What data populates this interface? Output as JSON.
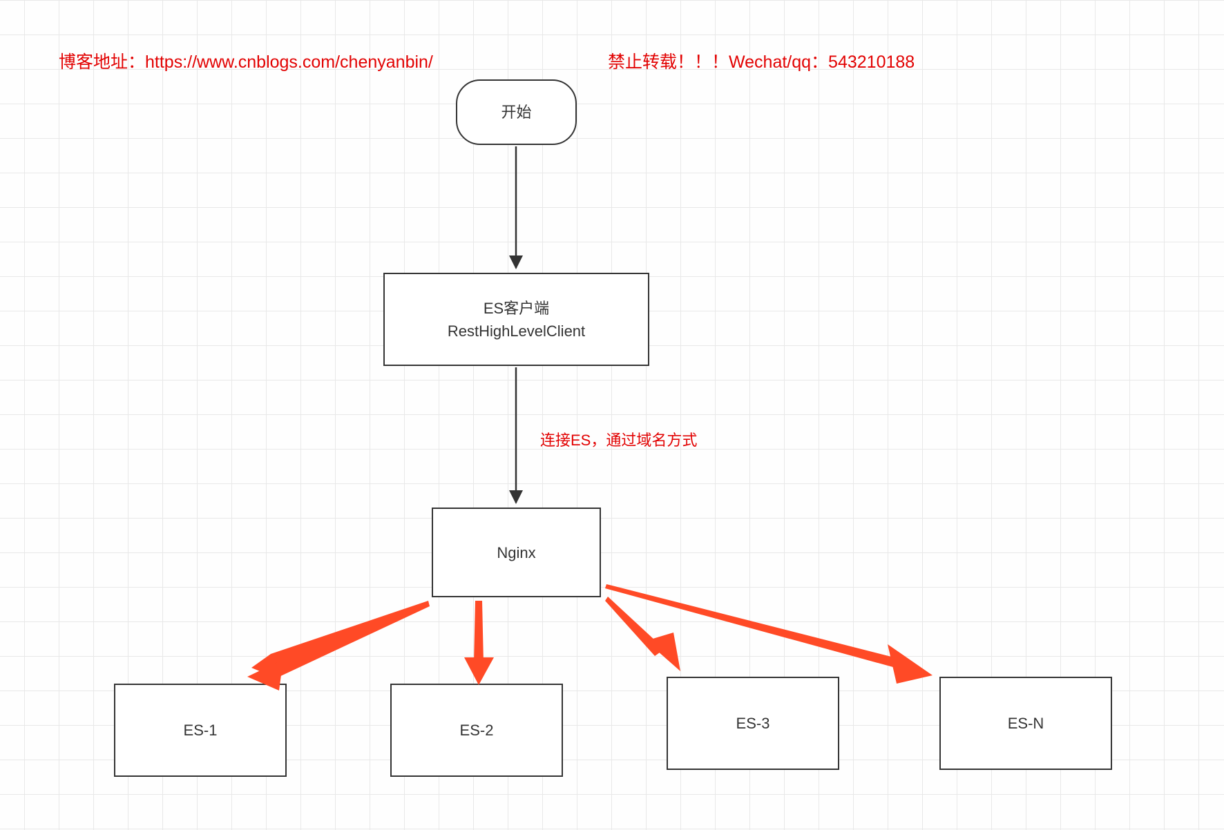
{
  "header": {
    "blog_label": "博客地址：https://www.cnblogs.com/chenyanbin/",
    "copyright_label": "禁止转载！！！Wechat/qq：543210188"
  },
  "nodes": {
    "start": "开始",
    "es_client_line1": "ES客户端",
    "es_client_line2": "RestHighLevelClient",
    "nginx": "Nginx",
    "es1": "ES-1",
    "es2": "ES-2",
    "es3": "ES-3",
    "esn": "ES-N"
  },
  "edges": {
    "connect_label": "连接ES，通过域名方式"
  },
  "colors": {
    "red_text": "#e20202",
    "red_arrow": "#ff4a26",
    "black": "#333333"
  }
}
